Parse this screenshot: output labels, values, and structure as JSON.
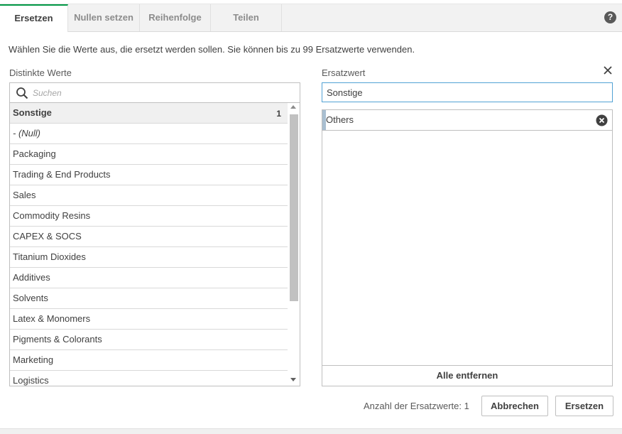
{
  "tabs": [
    {
      "label": "Ersetzen",
      "active": true
    },
    {
      "label": "Nullen setzen",
      "active": false
    },
    {
      "label": "Reihenfolge",
      "active": false
    },
    {
      "label": "Teilen",
      "active": false
    }
  ],
  "help_icon_glyph": "?",
  "description": "Wählen Sie die Werte aus, die ersetzt werden sollen. Sie können bis zu 99 Ersatzwerte verwenden.",
  "distinct": {
    "label": "Distinkte Werte",
    "search_placeholder": "Suchen",
    "rows": [
      {
        "label": "Sonstige",
        "count": "1"
      },
      {
        "label": "- (Null)"
      },
      {
        "label": "Packaging"
      },
      {
        "label": "Trading & End Products"
      },
      {
        "label": "Sales"
      },
      {
        "label": "Commodity Resins"
      },
      {
        "label": "CAPEX & SOCS"
      },
      {
        "label": "Titanium Dioxides"
      },
      {
        "label": "Additives"
      },
      {
        "label": "Solvents"
      },
      {
        "label": "Latex & Monomers"
      },
      {
        "label": "Pigments & Colorants"
      },
      {
        "label": "Marketing"
      },
      {
        "label": "Logistics"
      }
    ]
  },
  "replacement": {
    "label": "Ersatzwert",
    "value": "Sonstige",
    "items": [
      {
        "label": "Others"
      }
    ],
    "remove_all_label": "Alle entfernen"
  },
  "footer": {
    "count_text": "Anzahl der Ersatzwerte: 1",
    "cancel_label": "Abbrechen",
    "replace_label": "Ersetzen"
  },
  "colors": {
    "active_tab_accent": "#009845",
    "input_focus_border": "#52a2d4",
    "selected_row_bg": "#f0f0f0",
    "value_marker": "#a9bfd1"
  },
  "icons": {
    "help": "help-icon",
    "search": "search-icon",
    "close": "close-icon",
    "remove": "remove-icon"
  }
}
